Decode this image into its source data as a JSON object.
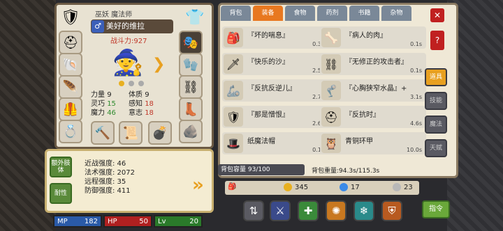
{
  "character": {
    "subtitle": "巫妖 魔法师",
    "gender_symbol": "♂",
    "name": "美好的维拉",
    "power": "战斗力:927",
    "stats": [
      {
        "label": "力量",
        "value": "9",
        "label2": "体质",
        "value2": "9"
      },
      {
        "label": "灵巧",
        "value": "15",
        "label2": "感知",
        "value2": "18"
      },
      {
        "label": "魔力",
        "value": "46",
        "label2": "意志",
        "value2": "18"
      }
    ]
  },
  "info": {
    "btn_extra": "额外肢体",
    "btn_resist": "耐性",
    "lines": [
      "近战强度: 46",
      "法术强度: 2072",
      "远程强度: 35",
      "防御强度: 411"
    ]
  },
  "bars": {
    "mp_label": "MP",
    "mp_value": "182",
    "hp_label": "HP",
    "hp_value": "50",
    "lv_label": "Lv",
    "lv_value": "20"
  },
  "tabs": [
    "背包",
    "装备",
    "食物",
    "药剂",
    "书籍",
    "杂物"
  ],
  "active_tab": "装备",
  "items": [
    {
      "name": "『坏的喘息』",
      "time": "0.3s",
      "icon": "🎒"
    },
    {
      "name": "『病人的肉』",
      "time": "0.1s",
      "icon": "🦴"
    },
    {
      "name": "『快乐的沙』",
      "time": "2.5s",
      "icon": "🗡"
    },
    {
      "name": "『无修正的攻击者』",
      "time": "0.1s",
      "icon": "⛓"
    },
    {
      "name": "『反抗反逆儿』",
      "time": "2.7s",
      "icon": "🦾"
    },
    {
      "name": "『心胸狭窄水晶』+",
      "time": "3.1s",
      "icon": "🦿"
    },
    {
      "name": "『那是憎恨』",
      "time": "2.6s",
      "icon": "🛡"
    },
    {
      "name": "『反抗时』",
      "time": "4.6s",
      "icon": "⛑"
    },
    {
      "name": "纸魔法帽",
      "time": "0.1s",
      "icon": "🎩"
    },
    {
      "name": "青铜环甲",
      "time": "10.0s",
      "icon": "🦉"
    }
  ],
  "capacity": "背包容量 93/100",
  "weight": "背包重量:94.3s/115.3s",
  "currency": {
    "gold": "345",
    "gem": "17",
    "silver": "23"
  },
  "side_tabs": [
    "道具",
    "技能",
    "魔法",
    "天赋"
  ],
  "command": "指令",
  "colors": {
    "accent": "#e87820",
    "tab": "#7a8898",
    "green": "#5a8a3a",
    "red": "#c02020"
  }
}
